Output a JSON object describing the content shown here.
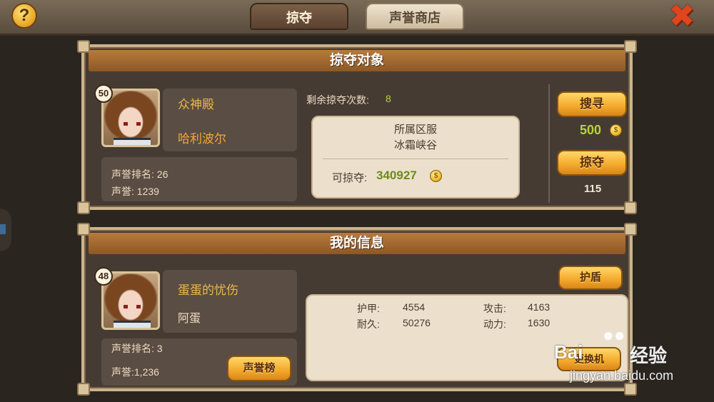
{
  "header": {
    "help_icon": "question-icon",
    "close_icon": "close-x-icon",
    "tabs": [
      {
        "label": "掠夺",
        "active": true
      },
      {
        "label": "声誉商店",
        "active": false
      }
    ]
  },
  "target": {
    "title": "掠夺对象",
    "level": "50",
    "guild": "众神殿",
    "name": "哈利波尔",
    "rank_label": "声誉排名: 26",
    "reputation_label": "声誉: 1239",
    "remaining_label": "剩余掠夺次数:",
    "remaining_value": "8",
    "server_label": "所属区服",
    "server_name": "冰霜峡谷",
    "lootable_label": "可掠夺:",
    "lootable_value": "340927",
    "search_button": "搜寻",
    "search_cost": "500",
    "rob_button": "掠夺",
    "rob_cost": "115"
  },
  "mine": {
    "title": "我的信息",
    "level": "48",
    "guild": "蛋蛋的忧伤",
    "name": "阿蛋",
    "rank_label": "声誉排名: 3",
    "reputation_label": "声誉:1,236",
    "leaderboard_button": "声誉榜",
    "shield_button": "护盾",
    "stats": {
      "armor_label": "护甲:",
      "armor_value": "4554",
      "attack_label": "攻击:",
      "attack_value": "4163",
      "durability_label": "耐久:",
      "durability_value": "50276",
      "power_label": "动力:",
      "power_value": "1630"
    },
    "partial_button": "更换机"
  },
  "watermark": {
    "brand": "Bai",
    "brand2": "经验",
    "url": "jingyan.baidu.com"
  },
  "colors": {
    "accent_gold": "#e9b84c",
    "accent_orange": "#f3a63b",
    "lootable_green": "#6e8a1a",
    "cost_green": "#b7d33c",
    "panel_bg": "#463b33"
  }
}
